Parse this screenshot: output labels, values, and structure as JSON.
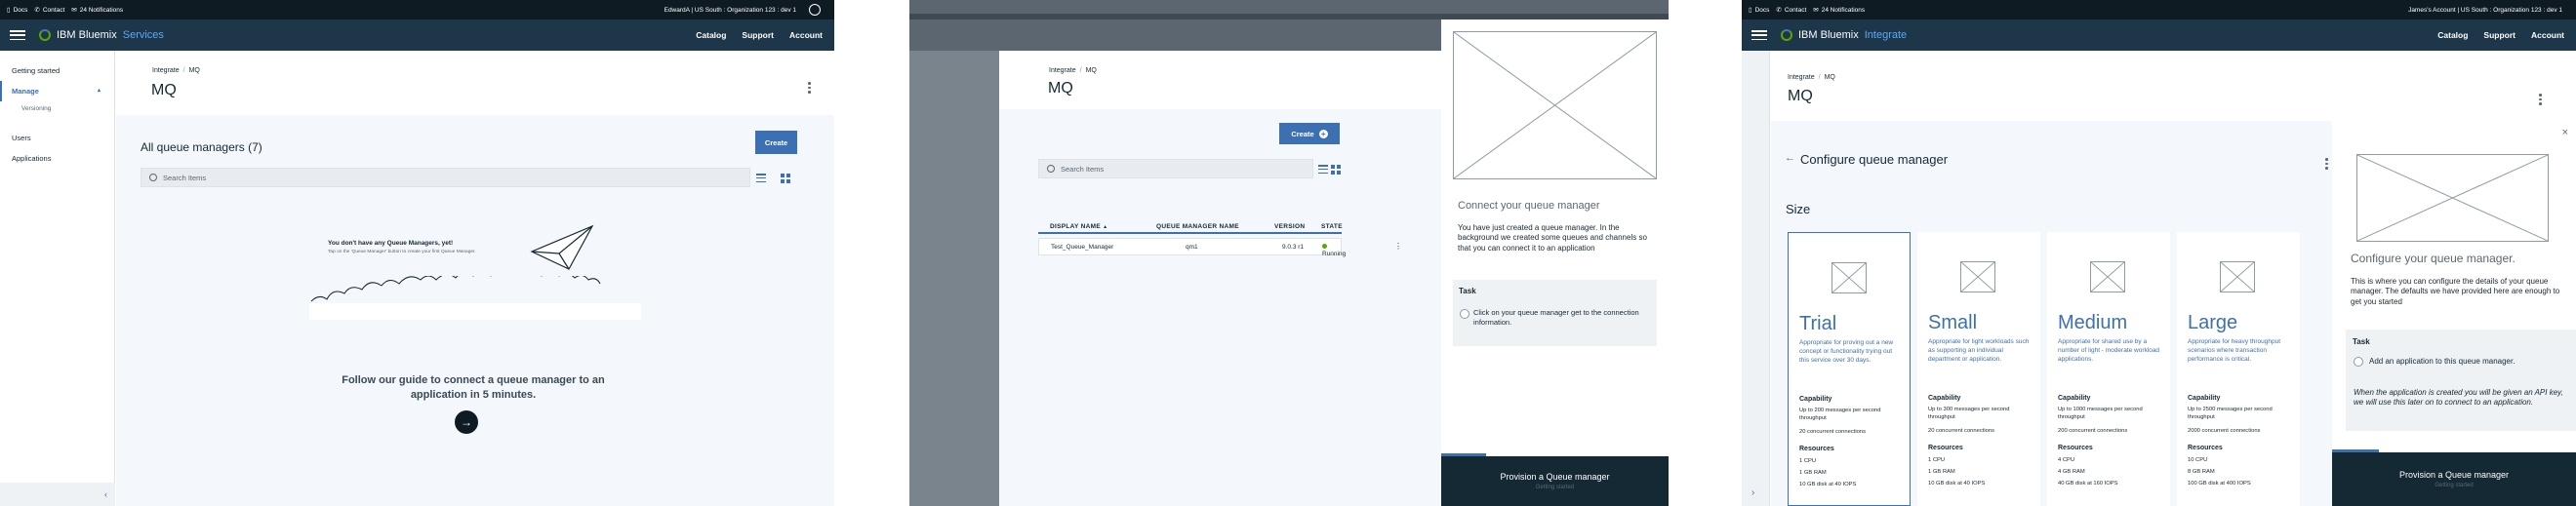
{
  "panel1": {
    "util": {
      "docs": "Docs",
      "contact": "Contact",
      "notifications": "24 Notifications",
      "account": "EdwardA | US South : Organization 123 : dev 1"
    },
    "brand": {
      "name": "IBM Bluemix",
      "section": "Services"
    },
    "nav": [
      "Catalog",
      "Support",
      "Account"
    ],
    "sidebar": {
      "getting_started": "Getting started",
      "manage": "Manage",
      "versioning": "Versioning",
      "users": "Users",
      "applications": "Applications",
      "collapse": "‹"
    },
    "breadcrumb": {
      "root": "Integrate",
      "sep": "/",
      "current": "MQ"
    },
    "title": "MQ",
    "section_title": "All queue managers (7)",
    "create": "Create",
    "search_placeholder": "Search Items",
    "empty_title": "You don't have any Queue Managers, yet!",
    "empty_sub": "Tap on the 'Queue Manager' button to create your first Queue Manager.",
    "guide": "Follow our guide to connect a queue manager to an application in 5 minutes.",
    "arrow": "→"
  },
  "panel2": {
    "breadcrumb": {
      "root": "Integrate",
      "sep": "/",
      "current": "MQ"
    },
    "title": "MQ",
    "create": "Create",
    "search_placeholder": "Search Items",
    "table": {
      "headers": [
        "DISPLAY NAME",
        "QUEUE MANAGER NAME",
        "VERSION",
        "STATE"
      ],
      "sort_arrow": "▲",
      "rows": [
        {
          "display_name": "Test_Queue_Manager",
          "qm_name": "qm1",
          "version": "9.0.3 r1",
          "state": "Running"
        }
      ]
    },
    "side": {
      "heading": "Connect your queue manager",
      "body": "You have just created a queue manager.  In the background we created some queues and channels so that you can connect it to an application",
      "task_label": "Task",
      "task_text": "Click on your queue manager get to the connection information.",
      "footer_title": "Provision a Queue manager",
      "footer_sub": "Getting started",
      "progress": 0.2
    }
  },
  "panel3": {
    "util": {
      "docs": "Docs",
      "contact": "Contact",
      "notifications": "24 Notifications",
      "account": "James's Account | US South : Organization 123 : dev 1"
    },
    "brand": {
      "name": "IBM Bluemix",
      "section": "Integrate"
    },
    "nav": [
      "Catalog",
      "Support",
      "Account"
    ],
    "breadcrumb": {
      "root": "Integrate",
      "sep": "/",
      "current": "MQ"
    },
    "title": "MQ",
    "configure_title": "Configure queue manager",
    "back": "←",
    "size_label": "Size",
    "close": "×",
    "plans": [
      {
        "name": "Trial",
        "desc": "Appropriate for proving out a new concept or functionality trying out this service over 30 days.",
        "cap_head": "Capability",
        "cap1": "Up to 200 messages per second throughput",
        "cap2": "20 concurrent connections",
        "res_head": "Resources",
        "r1": "1 CPU",
        "r2": "1 GB RAM",
        "r3": "10 GB disk at 40 IOPS"
      },
      {
        "name": "Small",
        "desc": "Appropriate for light workloads such as supporting an individual department or application.",
        "cap_head": "Capability",
        "cap1": "Up to 300 messages per second throughput",
        "cap2": "20 concurrent connections",
        "res_head": "Resources",
        "r1": "1 CPU",
        "r2": "1 GB RAM",
        "r3": "10 GB disk at 40 IOPS"
      },
      {
        "name": "Medium",
        "desc": "Appropriate for shared use by a number of light - moderate workload applications.",
        "cap_head": "Capability",
        "cap1": "Up to 1000 messages per second throughput",
        "cap2": "200 concurrent connections",
        "res_head": "Resources",
        "r1": "4 CPU",
        "r2": "4 GB RAM",
        "r3": "40 GB disk at 160 IOPS"
      },
      {
        "name": "Large",
        "desc": "Appropriate for heavy throughput scenarios where transaction performance is critical.",
        "cap_head": "Capability",
        "cap1": "Up to 2500 messages per second throughput",
        "cap2": "2000 concurrent connections",
        "res_head": "Resources",
        "r1": "10 CPU",
        "r2": "8 GB RAM",
        "r3": "100 GB disk at 400 IOPS"
      }
    ],
    "side": {
      "heading": "Configure your queue manager.",
      "body": "This is where you can configure the details of your queue manager.  The defaults we have provided here are enough to get you started",
      "task_label": "Task",
      "task_text": "Add an application to this queue manager.",
      "note": "When the application is created you will be given an API key, we will use this later on to connect to an application.",
      "footer_title": "Provision a Queue manager",
      "footer_sub": "Getting started",
      "progress": 0.2
    },
    "collapse": "›"
  },
  "colors": {
    "brand_blue": "#3d70b2",
    "nav_bg": "#1d3649",
    "util_bg": "#0f1b22",
    "running": "#5aa700"
  }
}
